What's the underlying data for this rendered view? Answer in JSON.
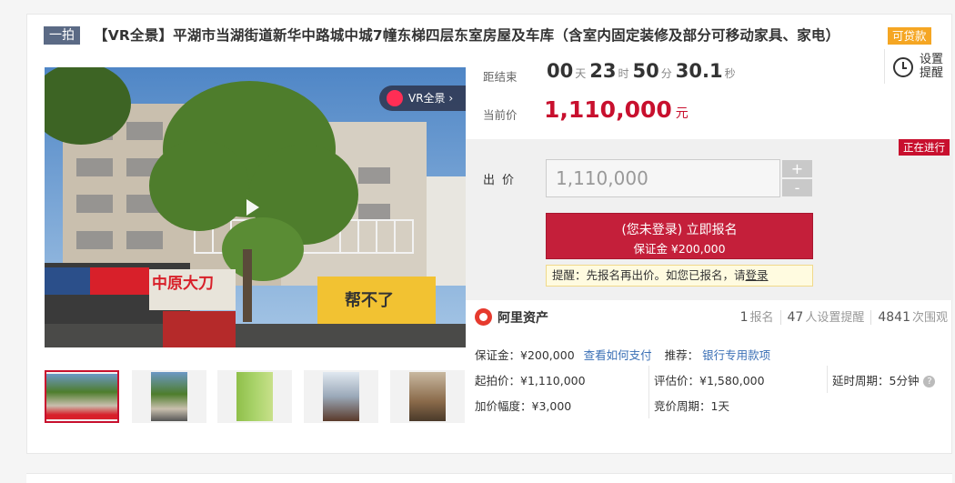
{
  "title": {
    "tag": "一拍",
    "text": "【VR全景】平湖市当湖街道新华中路城中城7幢东梯四层东室房屋及车库（含室内固定装修及部分可移动家具、家电）",
    "loan_tag": "可贷款"
  },
  "media": {
    "vr_badge": "VR全景",
    "thumbnail_count": 5,
    "shop_signs": [
      "中原大刀",
      "帮不了"
    ]
  },
  "countdown": {
    "label": "距结束",
    "days": "00",
    "days_unit": "天",
    "hours": "23",
    "hours_unit": "时",
    "minutes": "50",
    "minutes_unit": "分",
    "seconds": "30.1",
    "seconds_unit": "秒"
  },
  "reminder": {
    "label_line1": "设置",
    "label_line2": "提醒"
  },
  "current_price": {
    "label": "当前价",
    "value": "1,110,000",
    "unit": "元"
  },
  "bid": {
    "status": "正在进行",
    "label": "出价",
    "input_value": "1,110,000",
    "plus": "+",
    "minus": "-",
    "signup_line1": "(您未登录) 立即报名",
    "signup_line2": "保证金 ¥200,000",
    "hint_text": "提醒：先报名再出价。如您已报名，请",
    "hint_link": "登录"
  },
  "platform": {
    "name": "阿里资产"
  },
  "stats": {
    "signups": "1",
    "signups_label": "报名",
    "reminders": "47",
    "reminders_label": "人设置提醒",
    "views": "4841",
    "views_label": "次围观"
  },
  "details": {
    "deposit": "保证金：¥200,000",
    "how_to_pay": "查看如何支付",
    "recommend_label": "推荐：",
    "recommend_link": "银行专用款项",
    "start_price": "起拍价：¥1,110,000",
    "appraisal": "评估价：¥1,580,000",
    "delay_period": "延时周期：5分钟",
    "increment": "加价幅度：¥3,000",
    "bid_period": "竞价周期：1天"
  },
  "colors": {
    "accent": "#c8102e",
    "tag_gray": "#5b6a85",
    "loan_orange": "#f5a623",
    "link_blue": "#3a6fb5"
  }
}
